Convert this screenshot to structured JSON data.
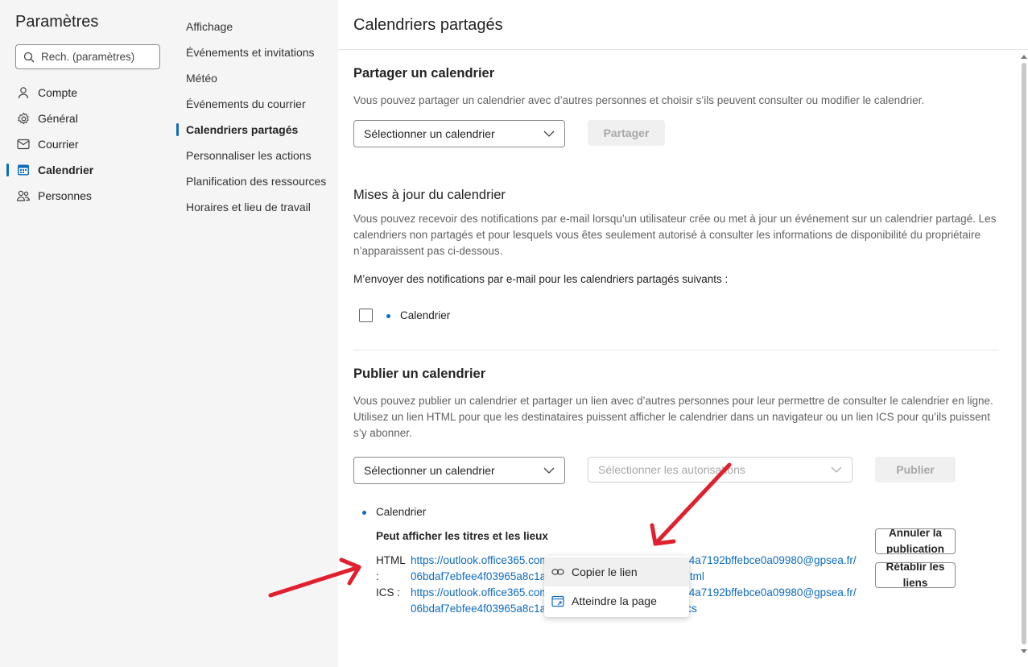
{
  "sidebar": {
    "title": "Paramètres",
    "search_placeholder": "Rech. (paramètres)",
    "items": [
      {
        "label": "Compte",
        "icon": "person-icon"
      },
      {
        "label": "Général",
        "icon": "gear-icon"
      },
      {
        "label": "Courrier",
        "icon": "mail-icon"
      },
      {
        "label": "Calendrier",
        "icon": "calendar-icon",
        "active": true
      },
      {
        "label": "Personnes",
        "icon": "people-icon"
      }
    ]
  },
  "subnav": {
    "items": [
      {
        "label": "Affichage"
      },
      {
        "label": "Événements et invitations"
      },
      {
        "label": "Météo"
      },
      {
        "label": "Événements du courrier"
      },
      {
        "label": "Calendriers partagés",
        "active": true
      },
      {
        "label": "Personnaliser les actions"
      },
      {
        "label": "Planification des ressources"
      },
      {
        "label": "Horaires et lieu de travail"
      }
    ]
  },
  "main": {
    "title": "Calendriers partagés",
    "share": {
      "heading": "Partager un calendrier",
      "description": "Vous pouvez partager un calendrier avec d’autres personnes et choisir s’ils peuvent consulter ou modifier le calendrier.",
      "select_placeholder": "Sélectionner un calendrier",
      "button": "Partager"
    },
    "updates": {
      "heading": "Mises à jour du calendrier",
      "description": "Vous pouvez recevoir des notifications par e-mail lorsqu’un utilisateur crée ou met à jour un événement sur un calendrier partagé. Les calendriers non partagés et pour lesquels vous êtes seulement autorisé à consulter les informations de disponibilité du propriétaire n’apparaissent pas ci-dessous.",
      "notify_label": "M’envoyer des notifications par e-mail pour les calendriers partagés suivants :",
      "calendar_label": "Calendrier",
      "checked": false
    },
    "publish": {
      "heading": "Publier un calendrier",
      "description": "Vous pouvez publier un calendrier et partager un lien avec d’autres personnes pour leur permettre de consulter le calendrier en ligne. Utilisez un lien HTML pour que les destinataires puissent afficher le calendrier dans un navigateur ou un lien ICS pour qu’ils puissent s’y abonner.",
      "select_calendar": "Sélectionner un calendrier",
      "select_permissions": "Sélectionner les autorisations",
      "button": "Publier",
      "calendar_name": "Calendrier",
      "permission": "Peut afficher les titres et les lieux",
      "html_label": "HTML :",
      "html_url": "https://outlook.office365.com/owa/calendar/6d51a7fe39634a7192bffebce0a09980@gpsea.fr/06bdaf7ebfee4f03965a8c1a2b7d0ab43054965/calendar.html",
      "ics_label": "ICS :",
      "ics_url": "https://outlook.office365.com/owa/calendar/6d51a7fe39634a7192bffebce0a09980@gpsea.fr/06bdaf7ebfee4f03965a8c1a2b7d0ab43054965/calendar.ics",
      "unpublish_button": "Annuler la publication",
      "reset_button": "Rétablir les liens"
    },
    "context_menu": {
      "items": [
        {
          "label": "Copier le lien",
          "icon": "link-icon"
        },
        {
          "label": "Atteindre la page",
          "icon": "open-page-icon"
        }
      ]
    }
  },
  "colors": {
    "accent": "#0f6cbd",
    "annotation_arrow": "#e0202e"
  }
}
